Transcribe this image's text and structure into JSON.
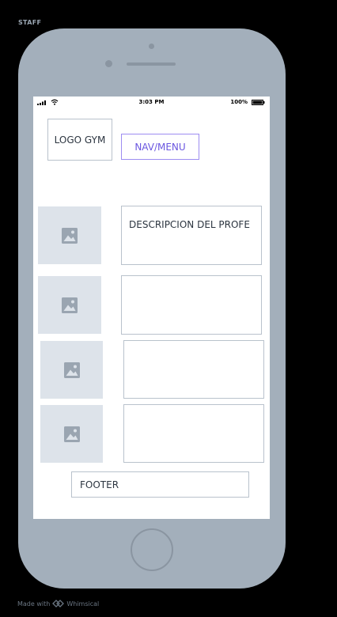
{
  "frame_label": "STAFF",
  "status_bar": {
    "time": "3:03 PM",
    "battery": "100%"
  },
  "header": {
    "logo": "LOGO GYM",
    "nav_label": "NAV/MENU"
  },
  "staff_list": [
    {
      "image_icon": "image-placeholder-icon",
      "description": "DESCRIPCION DEL PROFE"
    },
    {
      "image_icon": "image-placeholder-icon",
      "description": ""
    },
    {
      "image_icon": "image-placeholder-icon",
      "description": ""
    },
    {
      "image_icon": "image-placeholder-icon",
      "description": ""
    }
  ],
  "footer": {
    "label": "FOOTER"
  },
  "watermark": {
    "text": "Made with",
    "brand": "Whimsical"
  },
  "colors": {
    "background": "#000000",
    "phone_body": "#a3afbb",
    "screen": "#ffffff",
    "box_border": "#b9c2cc",
    "image_placeholder": "#dde3ea",
    "nav_accent": "#6a56e0"
  }
}
